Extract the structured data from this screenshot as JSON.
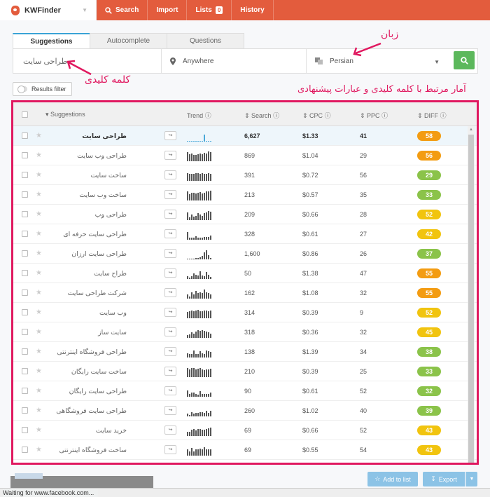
{
  "app": {
    "name": "KWFinder"
  },
  "nav": [
    {
      "label": "Search",
      "icon": "search-icon"
    },
    {
      "label": "Import"
    },
    {
      "label": "Lists",
      "badge": "0"
    },
    {
      "label": "History"
    }
  ],
  "tabs": [
    "Suggestions",
    "Autocomplete",
    "Questions"
  ],
  "search": {
    "keyword": "طراحی سایت",
    "location": "Anywhere",
    "language": "Persian"
  },
  "results_filter_label": "Results filter",
  "annotations": {
    "language": "زبان",
    "keyword": "کلمه کلیدی",
    "stats": "آمار مرتبط با کلمه کلیدی و عبارات پیشنهادی"
  },
  "columns": {
    "suggestions": "Suggestions",
    "trend": "Trend",
    "search": "Search",
    "cpc": "CPC",
    "ppc": "PPC",
    "diff": "DIFF"
  },
  "rows": [
    {
      "keyword": "طراحی سایت",
      "search": "6,627",
      "cpc": "$1.33",
      "ppc": "41",
      "diff": "58",
      "diff_color": "#f39c12",
      "trend": [
        0,
        0,
        0,
        0,
        0,
        0,
        0,
        0,
        9,
        0,
        0,
        0
      ]
    },
    {
      "keyword": "طراحی وب سایت",
      "search": "869",
      "cpc": "$1.04",
      "ppc": "29",
      "diff": "56",
      "diff_color": "#f39c12",
      "trend": [
        12,
        9,
        10,
        8,
        8,
        9,
        10,
        9,
        11,
        10,
        13,
        12
      ]
    },
    {
      "keyword": "ساخت سایت",
      "search": "391",
      "cpc": "$0.72",
      "ppc": "56",
      "diff": "29",
      "diff_color": "#8bc34a",
      "trend": [
        10,
        9,
        9,
        9,
        10,
        10,
        9,
        10,
        9,
        9,
        10,
        9
      ]
    },
    {
      "keyword": "ساخت وب سایت",
      "search": "213",
      "cpc": "$0.57",
      "ppc": "35",
      "diff": "33",
      "diff_color": "#8bc34a",
      "trend": [
        12,
        8,
        10,
        10,
        9,
        10,
        11,
        9,
        10,
        12,
        12,
        13
      ]
    },
    {
      "keyword": "طراحی وب",
      "search": "209",
      "cpc": "$0.66",
      "ppc": "28",
      "diff": "52",
      "diff_color": "#f1c40f",
      "trend": [
        10,
        4,
        7,
        5,
        6,
        9,
        7,
        6,
        9,
        10,
        12,
        11
      ]
    },
    {
      "keyword": "طراحی سایت حرفه ای",
      "search": "328",
      "cpc": "$0.61",
      "ppc": "27",
      "diff": "42",
      "diff_color": "#f1c40f",
      "trend": [
        10,
        3,
        3,
        3,
        5,
        3,
        3,
        3,
        4,
        4,
        4,
        6
      ]
    },
    {
      "keyword": "طراحی سایت ارزان",
      "search": "1,600",
      "cpc": "$0.86",
      "ppc": "26",
      "diff": "37",
      "diff_color": "#8bc34a",
      "trend": [
        1,
        1,
        1,
        1,
        2,
        2,
        3,
        5,
        9,
        12,
        6,
        2
      ]
    },
    {
      "keyword": "طراح سایت",
      "search": "50",
      "cpc": "$1.38",
      "ppc": "47",
      "diff": "55",
      "diff_color": "#f39c12",
      "trend": [
        4,
        2,
        4,
        7,
        6,
        5,
        10,
        5,
        4,
        9,
        6,
        3
      ]
    },
    {
      "keyword": "شرکت طراحی سایت",
      "search": "162",
      "cpc": "$1.08",
      "ppc": "32",
      "diff": "55",
      "diff_color": "#f39c12",
      "trend": [
        6,
        3,
        8,
        6,
        10,
        7,
        8,
        7,
        12,
        8,
        7,
        6
      ]
    },
    {
      "keyword": "وب سایت",
      "search": "314",
      "cpc": "$0.39",
      "ppc": "9",
      "diff": "52",
      "diff_color": "#f1c40f",
      "trend": [
        8,
        9,
        10,
        9,
        10,
        11,
        9,
        9,
        10,
        10,
        9,
        10
      ]
    },
    {
      "keyword": "سایت ساز",
      "search": "318",
      "cpc": "$0.36",
      "ppc": "32",
      "diff": "45",
      "diff_color": "#f1c40f",
      "trend": [
        4,
        5,
        7,
        6,
        8,
        10,
        9,
        10,
        9,
        8,
        7,
        6
      ]
    },
    {
      "keyword": "طراحی فروشگاه اینترنتی",
      "search": "138",
      "cpc": "$1.39",
      "ppc": "34",
      "diff": "38",
      "diff_color": "#8bc34a",
      "trend": [
        6,
        5,
        5,
        9,
        5,
        5,
        8,
        6,
        5,
        9,
        8,
        7
      ]
    },
    {
      "keyword": "ساخت سایت رایگان",
      "search": "210",
      "cpc": "$0.39",
      "ppc": "25",
      "diff": "33",
      "diff_color": "#8bc34a",
      "trend": [
        12,
        10,
        12,
        12,
        10,
        11,
        12,
        10,
        9,
        10,
        10,
        11
      ]
    },
    {
      "keyword": "طراحی سایت رایگان",
      "search": "90",
      "cpc": "$0.61",
      "ppc": "52",
      "diff": "32",
      "diff_color": "#8bc34a",
      "trend": [
        8,
        4,
        6,
        6,
        4,
        3,
        7,
        4,
        4,
        4,
        4,
        6
      ]
    },
    {
      "keyword": "طراحی سایت فروشگاهی",
      "search": "260",
      "cpc": "$1.02",
      "ppc": "40",
      "diff": "39",
      "diff_color": "#8bc34a",
      "trend": [
        4,
        2,
        6,
        4,
        5,
        5,
        6,
        6,
        5,
        7,
        5,
        7
      ]
    },
    {
      "keyword": "خرید سایت",
      "search": "69",
      "cpc": "$0.66",
      "ppc": "52",
      "diff": "43",
      "diff_color": "#f1c40f",
      "trend": [
        6,
        6,
        8,
        9,
        7,
        9,
        9,
        8,
        8,
        9,
        10,
        11
      ]
    },
    {
      "keyword": "ساخت فروشگاه اینترنتی",
      "search": "69",
      "cpc": "$0.55",
      "ppc": "54",
      "diff": "43",
      "diff_color": "#f1c40f",
      "trend": [
        8,
        6,
        10,
        6,
        8,
        8,
        9,
        8,
        11,
        8,
        8,
        8
      ]
    }
  ],
  "footer": {
    "add_to_list": "Add to list",
    "export": "Export"
  },
  "status_text": "Waiting for www.facebook.com..."
}
